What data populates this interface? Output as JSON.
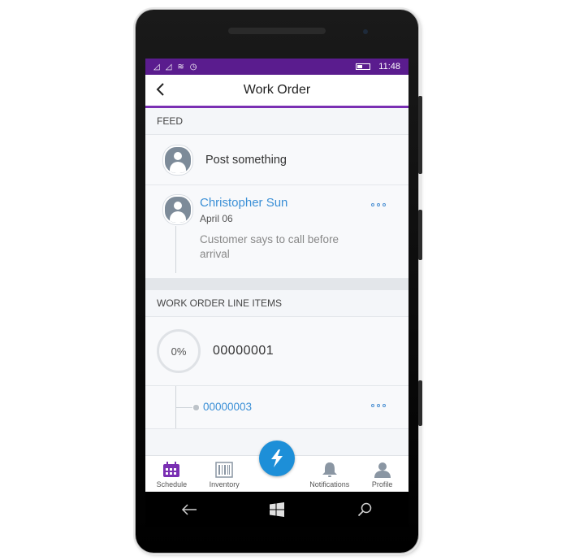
{
  "status": {
    "time": "11:48"
  },
  "header": {
    "title": "Work Order"
  },
  "feed": {
    "section_title": "FEED",
    "post_placeholder": "Post something",
    "item": {
      "author": "Christopher Sun",
      "date": "April 06",
      "message": "Customer says to call before arrival"
    }
  },
  "line_items": {
    "section_title": "WORK ORDER LINE ITEMS",
    "main": {
      "progress": "0%",
      "number": "00000001"
    },
    "children": [
      {
        "number": "00000003"
      }
    ]
  },
  "tabbar": {
    "items": [
      {
        "label": "Schedule"
      },
      {
        "label": "Inventory"
      },
      {
        "label": "Notifications"
      },
      {
        "label": "Profile"
      }
    ]
  },
  "colors": {
    "accent": "#7a2fb3",
    "statusbar": "#5a1c8e",
    "link": "#3a8fd6",
    "fab": "#1d8fd8"
  }
}
